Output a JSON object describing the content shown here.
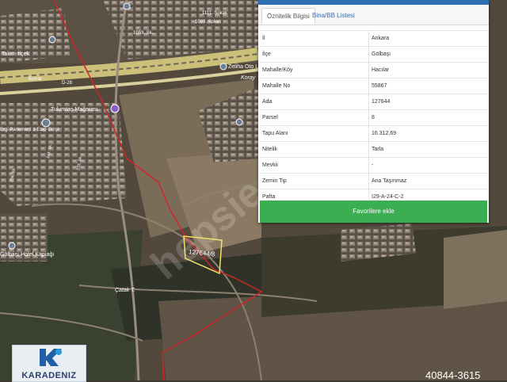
{
  "map": {
    "place_labels": {
      "mahalle_a": "1111. Sokak",
      "mahalle_b": "1099. Sokak",
      "mahalle_c": "1093. Sk.",
      "takim": "Takım İlçek",
      "bulvar": "Bulvar",
      "road_code": "D-28",
      "zeliha": "Zeliha Oto Lastik",
      "koray": "Koray",
      "magara": "Tulumtaş Mağarası",
      "parlament": "Ergi Parlement 1 Etap Girişi",
      "street_a": "244. Sk.",
      "street_b": "233. Sk.",
      "street_c": "236. Sk.",
      "hotel": "Gölbaşı Hotel Kapıağı",
      "catak": "Çatak T.",
      "parcel": "127644/8",
      "watermark": "hepsie"
    },
    "code_label": "40844-3615"
  },
  "panel": {
    "tabs": [
      {
        "label": "Öznitelik Bilgisi",
        "active": true
      },
      {
        "label": "Bina/BB Listesi",
        "active": false
      }
    ],
    "rows": [
      {
        "key": "İl",
        "value": "Ankara"
      },
      {
        "key": "İlçe",
        "value": "Gölbaşı"
      },
      {
        "key": "Mahalle/Köy",
        "value": "Hacılar"
      },
      {
        "key": "Mahalle No",
        "value": "55867"
      },
      {
        "key": "Ada",
        "value": "127644"
      },
      {
        "key": "Parsel",
        "value": "8"
      },
      {
        "key": "Tapu Alanı",
        "value": "16.312,69"
      },
      {
        "key": "Nitelik",
        "value": "Tarla"
      },
      {
        "key": "Mevkii",
        "value": "-"
      },
      {
        "key": "Zemin Tip",
        "value": "Ana Taşınmaz"
      },
      {
        "key": "Pafta",
        "value": "I29-A-24-C-2"
      }
    ],
    "favorite_button": "Favorilere ekle"
  },
  "logo": {
    "text": "KARADENIZ"
  },
  "colors": {
    "fav_green": "#3cae52",
    "panel_blue": "#2f6eb3",
    "boundary_red": "#d0252b",
    "parcel_yellow": "#f4e26a"
  }
}
